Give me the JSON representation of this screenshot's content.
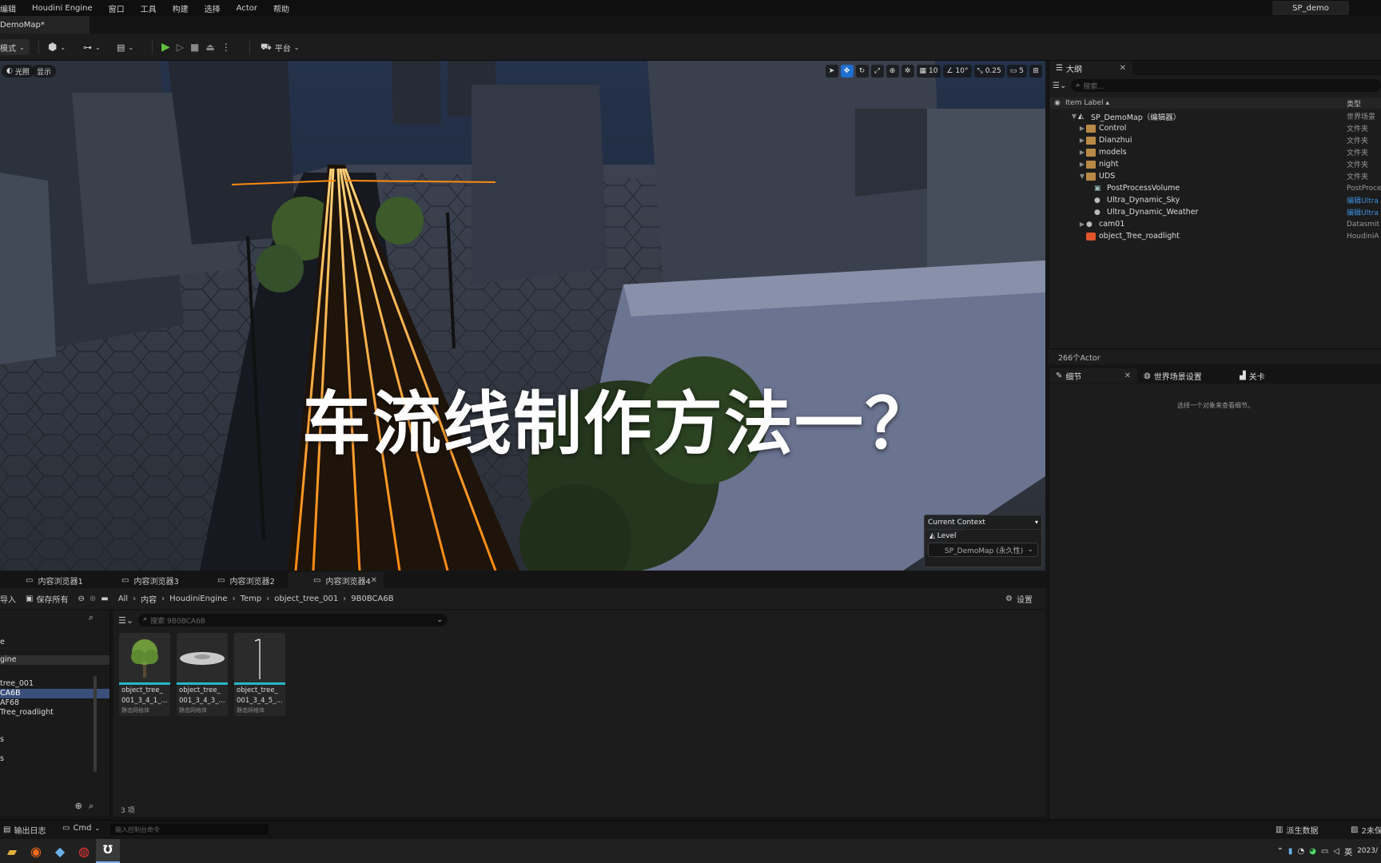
{
  "menu": [
    "编辑",
    "Houdini Engine",
    "窗口",
    "工具",
    "构建",
    "选择",
    "Actor",
    "帮助"
  ],
  "project_name": "SP_demo",
  "map_tab": "DemoMap*",
  "toolbar": {
    "mode_label": "模式",
    "platform_label": "平台"
  },
  "viewport": {
    "lit_label": "光照",
    "show_label": "显示",
    "grid_snap": "10",
    "rotation_snap": "10°",
    "scale_snap": "0.25",
    "camera_speed": "5"
  },
  "overlay_title": "车流线制作方法一？",
  "context": {
    "title": "Current Context",
    "level_label": "Level",
    "level_value": "SP_DemoMap (永久性)"
  },
  "outliner": {
    "tab_title": "大纲",
    "search_placeholder": "搜索...",
    "col_label": "Item Label ▴",
    "col_type": "类型",
    "rows": [
      {
        "label": "SP_DemoMap（编辑器）",
        "type": "世界场景",
        "indent": 0,
        "icon": "level",
        "arrow": "▼"
      },
      {
        "label": "Control",
        "type": "文件夹",
        "indent": 1,
        "icon": "folder",
        "arrow": "▶"
      },
      {
        "label": "Dianzhui",
        "type": "文件夹",
        "indent": 1,
        "icon": "folder",
        "arrow": "▶"
      },
      {
        "label": "models",
        "type": "文件夹",
        "indent": 1,
        "icon": "folder",
        "arrow": "▶"
      },
      {
        "label": "night",
        "type": "文件夹",
        "indent": 1,
        "icon": "folder",
        "arrow": "▶"
      },
      {
        "label": "UDS",
        "type": "文件夹",
        "indent": 1,
        "icon": "folder",
        "arrow": "▼"
      },
      {
        "label": "PostProcessVolume",
        "type": "PostProcess",
        "indent": 2,
        "icon": "volume",
        "arrow": ""
      },
      {
        "label": "Ultra_Dynamic_Sky",
        "type": "编辑Ultra",
        "indent": 2,
        "icon": "actor",
        "arrow": "",
        "link": true
      },
      {
        "label": "Ultra_Dynamic_Weather",
        "type": "编辑Ultra",
        "indent": 2,
        "icon": "actor",
        "arrow": "",
        "link": true
      },
      {
        "label": "cam01",
        "type": "Datasmit",
        "indent": 1,
        "icon": "actor",
        "arrow": "▶"
      },
      {
        "label": "object_Tree_roadlight",
        "type": "HoudiniA",
        "indent": 1,
        "icon": "houdini",
        "arrow": ""
      }
    ],
    "actor_count": "266个Actor"
  },
  "details": {
    "tabs": [
      "细节",
      "世界场景设置",
      "关卡"
    ],
    "empty_text": "选择一个对象来查看细节。"
  },
  "content_browser": {
    "tabs": [
      "内容浏览器1",
      "内容浏览器3",
      "内容浏览器2",
      "内容浏览器4"
    ],
    "import_label": "导入",
    "save_all_label": "保存所有",
    "breadcrumbs": [
      "All",
      "内容",
      "HoudiniEngine",
      "Temp",
      "object_tree_001",
      "9B0BCA6B"
    ],
    "settings_label": "设置",
    "search_placeholder": "搜索 9B0BCA6B",
    "tree": [
      "e",
      "gine",
      "tree_001",
      "CA6B",
      "AF68",
      "Tree_roadlight",
      "s",
      "s"
    ],
    "assets": [
      {
        "name1": "object_tree_",
        "name2": "001_3_4_1_...",
        "type": "静态网格体",
        "thumb": "tree"
      },
      {
        "name1": "object_tree_",
        "name2": "001_3_4_3_...",
        "type": "静态网格体",
        "thumb": "disc"
      },
      {
        "name1": "object_tree_",
        "name2": "001_3_4_5_...",
        "type": "静态网格体",
        "thumb": "lamp"
      }
    ],
    "item_count": "3 项"
  },
  "statusbar": {
    "output_log": "输出日志",
    "cmd_label": "Cmd",
    "cmd_placeholder": "输入控制台命令",
    "derived_data": "派生数据",
    "unsaved": "2未保"
  },
  "taskbar": {
    "lang": "英",
    "date": "2023/"
  },
  "colors": {
    "accent": "#1e6fd0",
    "streak": "#ff9a1a",
    "folder": "#b98a45",
    "asset_bar": "#27b7c9"
  }
}
